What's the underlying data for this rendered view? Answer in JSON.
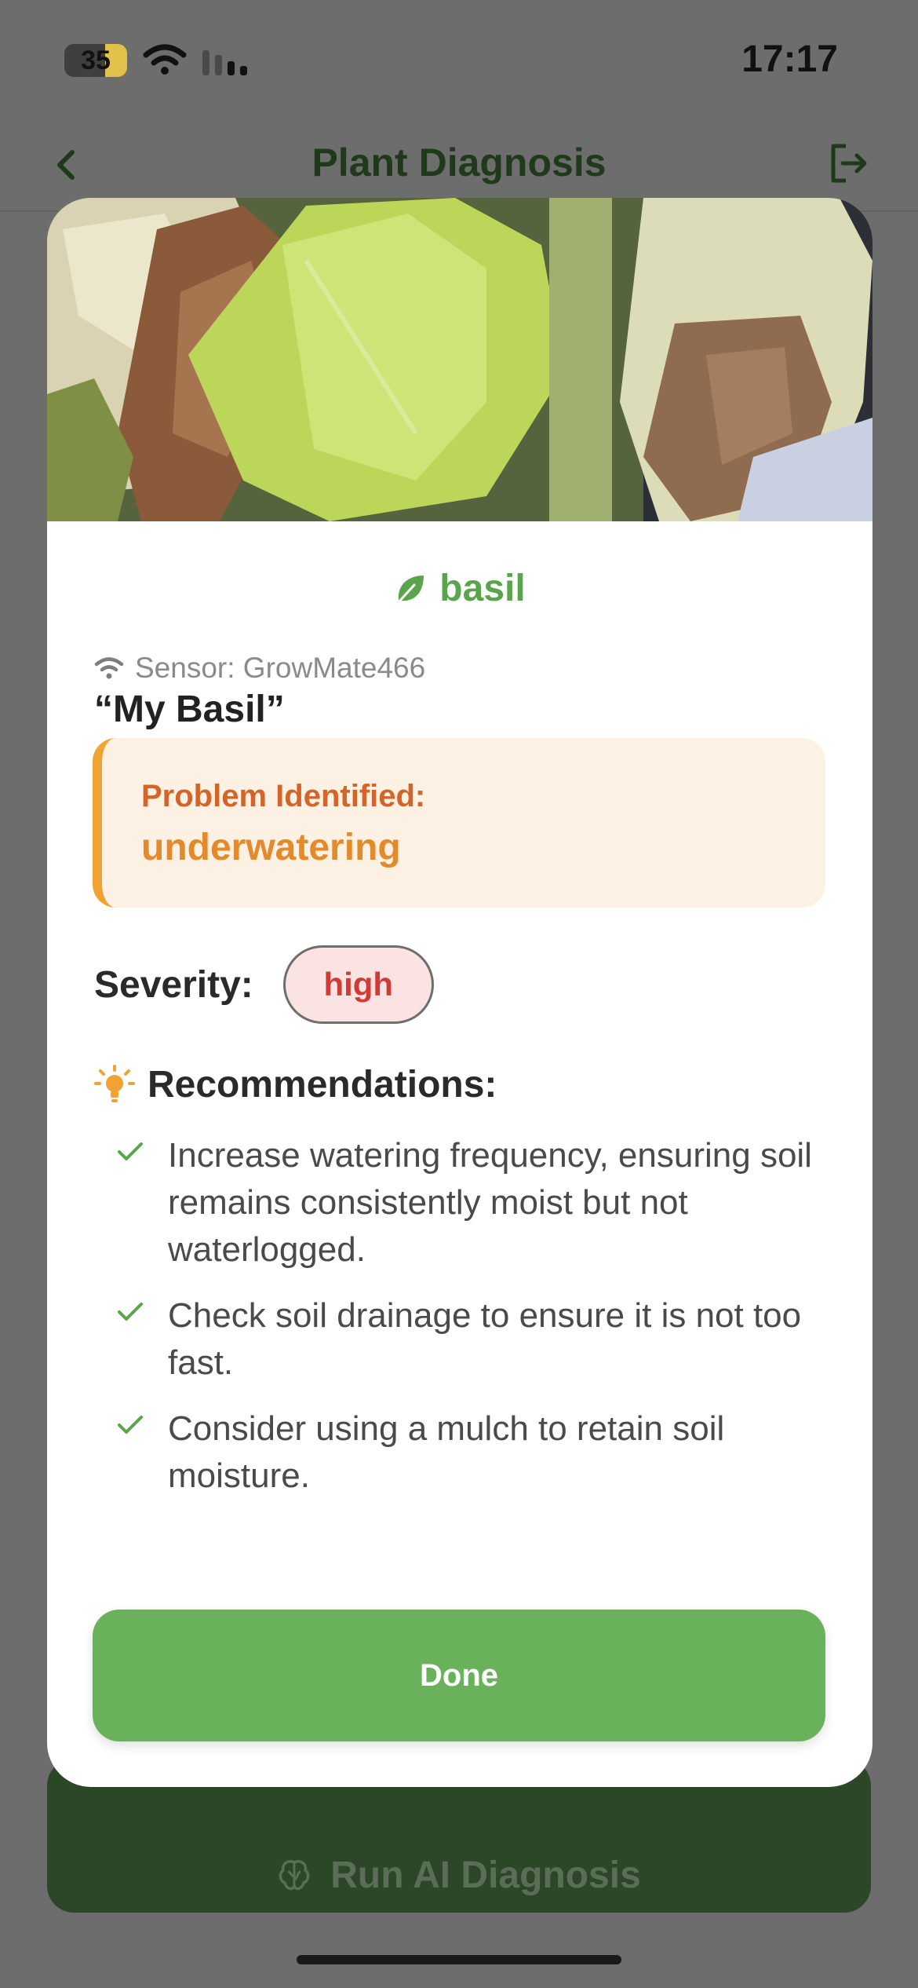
{
  "status_bar": {
    "battery_percent": "35",
    "battery_level": 0.35,
    "time": "17:17"
  },
  "nav": {
    "title": "Plant Diagnosis",
    "back_icon": "chevron-left-icon",
    "logout_icon": "logout-icon"
  },
  "modal": {
    "plant_type": "basil",
    "sensor_label": "Sensor: GrowMate466",
    "plant_name": "“My Basil”",
    "problem_title": "Problem Identified:",
    "problem_value": "underwatering",
    "severity_label": "Severity:",
    "severity_value": "high",
    "recommendations_title": "Recommendations:",
    "recommendations": [
      "Increase watering frequency, ensuring soil remains consistently moist but not waterlogged.",
      "Check soil drainage to ensure it is not too fast.",
      "Consider using a mulch to retain soil moisture."
    ],
    "done_label": "Done"
  },
  "background": {
    "run_button_label": "Run AI Diagnosis"
  },
  "colors": {
    "accent_green": "#6ab15b",
    "dark_green": "#2c4728",
    "warning_orange": "#e58a2b",
    "severity_red": "#cf3b35"
  }
}
